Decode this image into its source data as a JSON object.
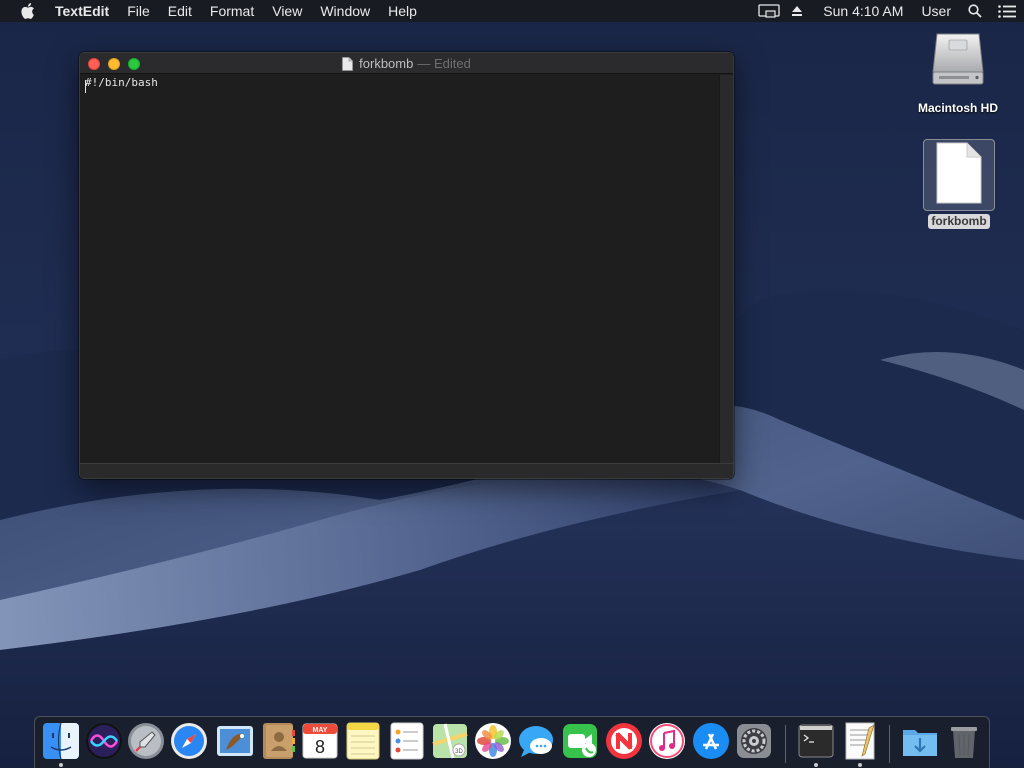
{
  "menubar": {
    "apple_icon": "apple-logo-icon",
    "app_name": "TextEdit",
    "menus": [
      "File",
      "Edit",
      "Format",
      "View",
      "Window",
      "Help"
    ],
    "status_icons": [
      "display-mirroring-icon",
      "eject-icon"
    ],
    "clock": "Sun 4:10 AM",
    "user": "User",
    "spotlight_icon": "search-icon",
    "notification_icon": "notification-center-icon"
  },
  "window": {
    "title": "forkbomb",
    "edited_suffix": "— Edited",
    "content": "#!/bin/bash"
  },
  "desktop": {
    "icons": [
      {
        "label": "Macintosh HD",
        "icon": "hard-drive-icon"
      },
      {
        "label": "forkbomb",
        "icon": "text-document-icon",
        "selected": true
      }
    ]
  },
  "dock": {
    "calendar": {
      "month": "MAY",
      "day": "8"
    },
    "items": [
      {
        "name": "Finder",
        "icon": "finder-icon",
        "running": true
      },
      {
        "name": "Siri",
        "icon": "siri-icon",
        "running": false
      },
      {
        "name": "Launchpad",
        "icon": "launchpad-icon",
        "running": false
      },
      {
        "name": "Safari",
        "icon": "safari-icon",
        "running": false
      },
      {
        "name": "Mail",
        "icon": "mail-icon",
        "running": false
      },
      {
        "name": "Contacts",
        "icon": "contacts-icon",
        "running": false
      },
      {
        "name": "Calendar",
        "icon": "calendar-icon",
        "running": false
      },
      {
        "name": "Notes",
        "icon": "notes-icon",
        "running": false
      },
      {
        "name": "Reminders",
        "icon": "reminders-icon",
        "running": false
      },
      {
        "name": "Maps",
        "icon": "maps-icon",
        "running": false
      },
      {
        "name": "Photos",
        "icon": "photos-icon",
        "running": false
      },
      {
        "name": "Messages",
        "icon": "messages-icon",
        "running": false
      },
      {
        "name": "FaceTime",
        "icon": "facetime-icon",
        "running": false
      },
      {
        "name": "News",
        "icon": "news-icon",
        "running": false
      },
      {
        "name": "iTunes",
        "icon": "itunes-icon",
        "running": false
      },
      {
        "name": "App Store",
        "icon": "app-store-icon",
        "running": false
      },
      {
        "name": "System Preferences",
        "icon": "system-preferences-icon",
        "running": false
      },
      {
        "name": "Terminal",
        "icon": "terminal-icon",
        "running": true
      },
      {
        "name": "TextEdit",
        "icon": "textedit-icon",
        "running": true
      },
      {
        "name": "Downloads",
        "icon": "downloads-folder-icon",
        "running": false
      },
      {
        "name": "Trash",
        "icon": "trash-icon",
        "running": false
      }
    ]
  },
  "colors": {
    "close": "#ff5f57",
    "minimize": "#febc2e",
    "zoom": "#28c840",
    "window_bg": "#1e1e1e",
    "desktop_bg": "#16213c"
  }
}
